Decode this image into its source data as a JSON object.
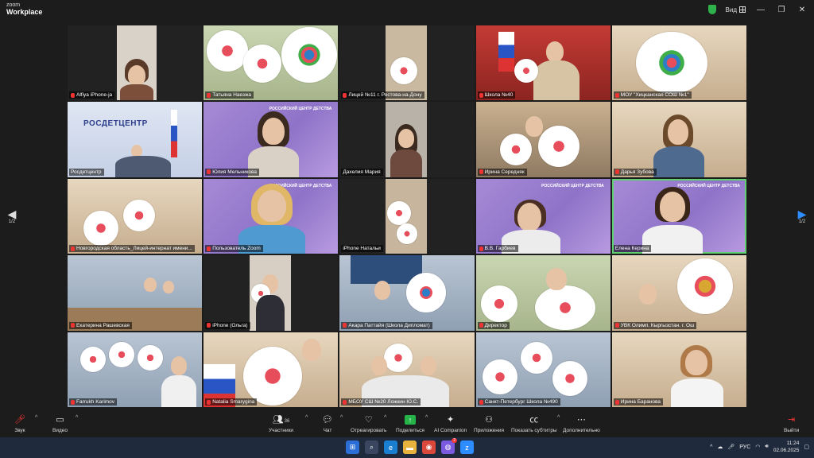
{
  "window": {
    "brand_top": "zoom",
    "brand_bottom": "Workplace",
    "view_label": "Вид",
    "minimize": "—",
    "restore": "❐",
    "close": "✕"
  },
  "nav": {
    "left_page": "1/2",
    "right_page": "1/2",
    "left_arrow": "◀",
    "right_arrow": "▶"
  },
  "participants": [
    {
      "name": "Alfiya iPhone-ja"
    },
    {
      "name": "Татьяна Наезжа"
    },
    {
      "name": "Лицей №11 г. Ростова-на-Дону"
    },
    {
      "name": "Школа №40"
    },
    {
      "name": "МОУ \"Хицканская СОШ №1\""
    },
    {
      "name": "Росдетцентр"
    },
    {
      "name": "Юлия Мельникова"
    },
    {
      "name": "Дахелия Мария"
    },
    {
      "name": "Ирина Середняк"
    },
    {
      "name": "Дарья Зубова"
    },
    {
      "name": "Новгородская область_Лицей-интернат имени..."
    },
    {
      "name": "Пользователь Zoom"
    },
    {
      "name": "iPhone Натальи"
    },
    {
      "name": "В.В. Гарбиев"
    },
    {
      "name": "Елена Керина"
    },
    {
      "name": "Екатерина Рашевская"
    },
    {
      "name": "iPhone (Ольга)"
    },
    {
      "name": "Акара Паттайя (Школа Дипломат)"
    },
    {
      "name": "Директор"
    },
    {
      "name": "УВК Олимп. Кыргызстан. г. Ош"
    },
    {
      "name": "Farrukh Karimov"
    },
    {
      "name": "Natalia Smarygina"
    },
    {
      "name": "МБОУ СШ №20 Ложкин Ю.С."
    },
    {
      "name": "Санкт-Петербург Школа №490"
    },
    {
      "name": "Ирина Баранова"
    }
  ],
  "banner": {
    "rosdet_text": "РОСДЕТЦЕНТР",
    "purple_logo": "РОССИЙСКИЙ ЦЕНТР ДЕТСТВА"
  },
  "toolbar": {
    "audio": "Звук",
    "video": "Видео",
    "participants": "Участники",
    "participants_count": "36",
    "chat": "Чат",
    "react": "Отреагировать",
    "share": "Поделиться",
    "ai": "AI Companion",
    "apps": "Приложения",
    "captions": "Показать субтитры",
    "more": "Дополнительно",
    "leave": "Выйти"
  },
  "taskbar": {
    "lang": "РУС",
    "time": "11:24",
    "date": "02.06.2025",
    "notif_count": "2"
  },
  "colors": {
    "accent_green": "#25b34a",
    "active_border": "#5fcf6f",
    "taskbar": "#202a3d",
    "purple_bg": "#9b80cf"
  }
}
